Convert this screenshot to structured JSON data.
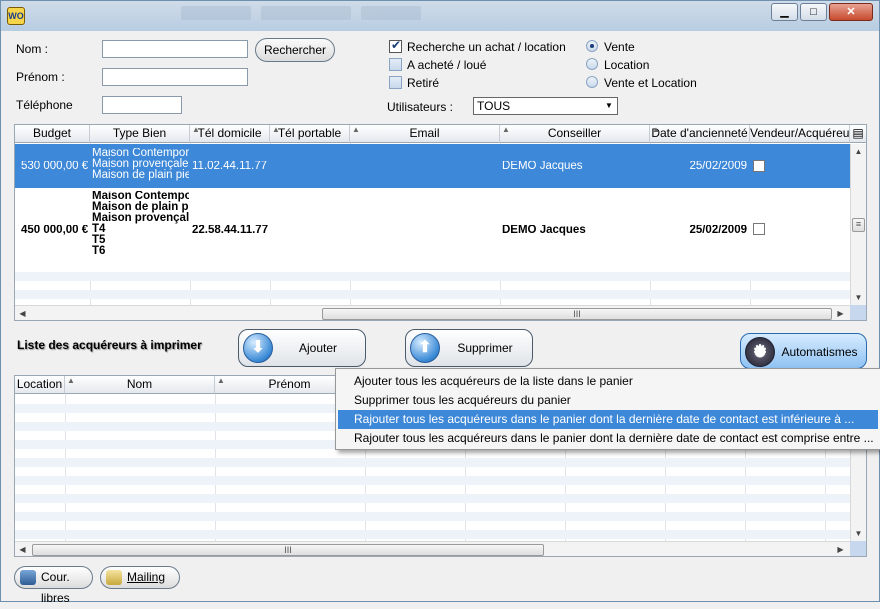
{
  "search": {
    "nom_label": "Nom :",
    "prenom_label": "Prénom :",
    "telephone_label": "Téléphone",
    "nom_value": "",
    "prenom_value": "",
    "telephone_value": "",
    "search_button": "Rechercher",
    "checkboxes": [
      {
        "label": "Recherche un achat / location",
        "checked": true
      },
      {
        "label": "A acheté / loué",
        "checked": false
      },
      {
        "label": "Retiré",
        "checked": false
      }
    ],
    "radios": [
      {
        "label": "Vente",
        "selected": true
      },
      {
        "label": "Location",
        "selected": false
      },
      {
        "label": "Vente et Location",
        "selected": false
      }
    ],
    "users_label": "Utilisateurs :",
    "users_value": "TOUS"
  },
  "results_table": {
    "columns": [
      "Budget",
      "Type Bien",
      "Tél domicile",
      "Tél portable",
      "Email",
      "Conseiller",
      "Date d'ancienneté",
      "Vendeur/Acquéreur"
    ],
    "rows": [
      {
        "budget": "530 000,00 €",
        "type_bien": [
          "Maison Contemporai",
          "Maison provençale",
          "Maison de plain pied"
        ],
        "tel_domicile": "11.02.44.11.77",
        "tel_portable": "",
        "email": "",
        "conseiller": "DEMO Jacques",
        "date": "25/02/2009",
        "vendeur_acquereur": false
      },
      {
        "budget": "450 000,00 €",
        "type_bien": [
          "Maison Contemporai",
          "Maison de plain pied",
          "Maison provençale",
          "T4",
          "T5",
          "T6"
        ],
        "tel_domicile": "22.58.44.11.77",
        "tel_portable": "",
        "email": "",
        "conseiller": "DEMO Jacques",
        "date": "25/02/2009",
        "vendeur_acquereur": false
      }
    ],
    "hscroll_label": "III"
  },
  "print_section": {
    "title": "Liste des acquéreurs à imprimer",
    "add_button": "Ajouter",
    "remove_button": "Supprimer",
    "auto_button": "Automatismes",
    "columns": [
      "Location",
      "Nom",
      "Prénom"
    ],
    "hscroll_label": "III"
  },
  "context_menu": {
    "items": [
      "Ajouter tous les acquéreurs de la liste dans le panier",
      "Supprimer tous les acquéreurs du panier",
      "Rajouter tous les acquéreurs dans le panier dont la dernière date de contact est inférieure à ...",
      "Rajouter tous les acquéreurs dans le panier dont la dernière date de contact est comprise entre ..."
    ],
    "highlighted_index": 2
  },
  "footer": {
    "courriers_button": "Cour. libres",
    "mailing_button": "Mailing"
  },
  "window": {
    "icon_text": "WO"
  },
  "colors": {
    "selection": "#3d88d8",
    "row_alt": "#eef3fa"
  }
}
